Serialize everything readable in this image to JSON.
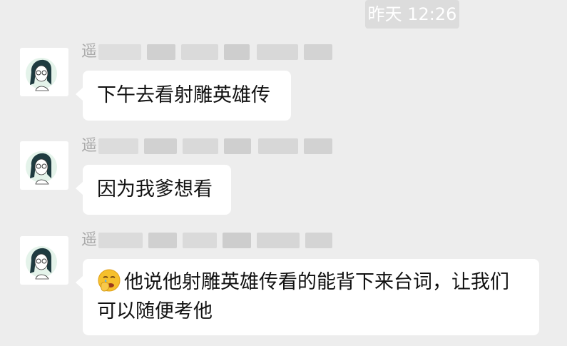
{
  "timestamp": "昨天 12:26",
  "messages": [
    {
      "sender": "遥                ",
      "text": "下午去看射雕英雄传"
    },
    {
      "sender": "遥                ",
      "text": "因为我爹想看"
    },
    {
      "sender": "遥                ",
      "emoji": "face-palm-emoji",
      "text_line1": "他说他射雕英雄传看的能背下来台词，让我们",
      "text_line2": "可以随便考他"
    }
  ]
}
